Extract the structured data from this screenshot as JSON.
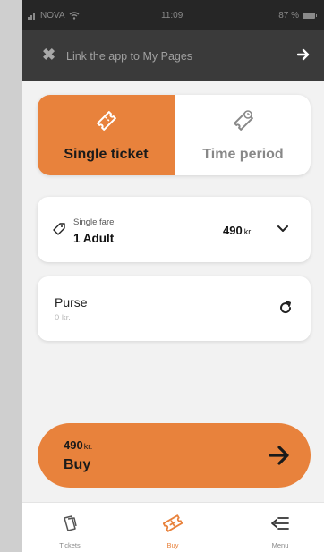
{
  "status_bar": {
    "carrier": "NOVA",
    "time": "11:09",
    "battery": "87 %"
  },
  "link_bar": {
    "text": "Link the app to My Pages",
    "close_icon": "close-icon",
    "arrow_icon": "arrow-right-icon"
  },
  "ticket_type": {
    "options": [
      {
        "label": "Single ticket",
        "icon": "ticket-icon",
        "selected": true
      },
      {
        "label": "Time period",
        "icon": "ticket-clock-icon",
        "selected": false
      }
    ]
  },
  "fare": {
    "type_label": "Single fare",
    "passengers": "1 Adult",
    "price": "490",
    "currency": "kr."
  },
  "purse": {
    "title": "Purse",
    "balance": "0 kr."
  },
  "buy": {
    "price": "490",
    "currency": "kr.",
    "label": "Buy"
  },
  "tab_bar": {
    "tabs": [
      {
        "label": "Tickets",
        "icon": "tickets-icon"
      },
      {
        "label": "Buy",
        "icon": "buy-ticket-icon",
        "active": true
      },
      {
        "label": "Menu",
        "icon": "menu-icon"
      }
    ]
  },
  "colors": {
    "accent": "#e8823c",
    "header_bg": "#3a3a3a",
    "status_bg": "#262626",
    "background": "#f2f2f2"
  }
}
